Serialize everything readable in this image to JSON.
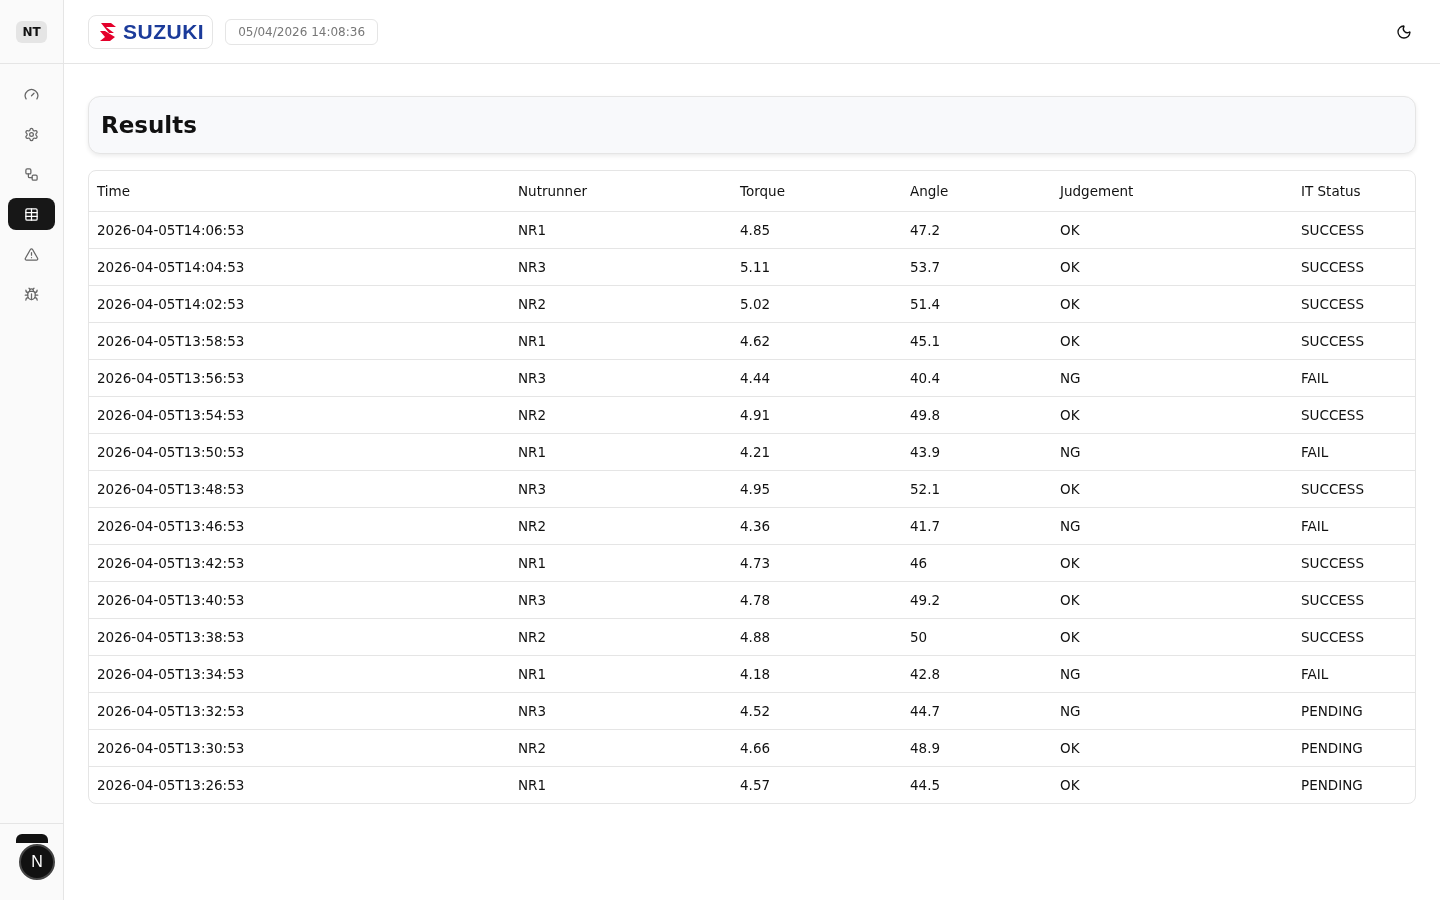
{
  "sidebar": {
    "badge": "NT",
    "items": [
      {
        "kind": "gauge",
        "selected": false
      },
      {
        "kind": "gear",
        "selected": false
      },
      {
        "kind": "network",
        "selected": false
      },
      {
        "kind": "table",
        "selected": true
      },
      {
        "kind": "warning",
        "selected": false
      },
      {
        "kind": "bug",
        "selected": false
      }
    ],
    "dev_badge": "N"
  },
  "header": {
    "logo": "SUZUKI",
    "datetime": "05/04/2026 14:08:36"
  },
  "title": "Results",
  "table": {
    "columns": [
      "Time",
      "Nutrunner",
      "Torque",
      "Angle",
      "Judgement",
      "IT Status"
    ],
    "rows": [
      [
        "2026-04-05T14:06:53",
        "NR1",
        "4.85",
        "47.2",
        "OK",
        "SUCCESS"
      ],
      [
        "2026-04-05T14:04:53",
        "NR3",
        "5.11",
        "53.7",
        "OK",
        "SUCCESS"
      ],
      [
        "2026-04-05T14:02:53",
        "NR2",
        "5.02",
        "51.4",
        "OK",
        "SUCCESS"
      ],
      [
        "2026-04-05T13:58:53",
        "NR1",
        "4.62",
        "45.1",
        "OK",
        "SUCCESS"
      ],
      [
        "2026-04-05T13:56:53",
        "NR3",
        "4.44",
        "40.4",
        "NG",
        "FAIL"
      ],
      [
        "2026-04-05T13:54:53",
        "NR2",
        "4.91",
        "49.8",
        "OK",
        "SUCCESS"
      ],
      [
        "2026-04-05T13:50:53",
        "NR1",
        "4.21",
        "43.9",
        "NG",
        "FAIL"
      ],
      [
        "2026-04-05T13:48:53",
        "NR3",
        "4.95",
        "52.1",
        "OK",
        "SUCCESS"
      ],
      [
        "2026-04-05T13:46:53",
        "NR2",
        "4.36",
        "41.7",
        "NG",
        "FAIL"
      ],
      [
        "2026-04-05T13:42:53",
        "NR1",
        "4.73",
        "46",
        "OK",
        "SUCCESS"
      ],
      [
        "2026-04-05T13:40:53",
        "NR3",
        "4.78",
        "49.2",
        "OK",
        "SUCCESS"
      ],
      [
        "2026-04-05T13:38:53",
        "NR2",
        "4.88",
        "50",
        "OK",
        "SUCCESS"
      ],
      [
        "2026-04-05T13:34:53",
        "NR1",
        "4.18",
        "42.8",
        "NG",
        "FAIL"
      ],
      [
        "2026-04-05T13:32:53",
        "NR3",
        "4.52",
        "44.7",
        "NG",
        "PENDING"
      ],
      [
        "2026-04-05T13:30:53",
        "NR2",
        "4.66",
        "48.9",
        "OK",
        "PENDING"
      ],
      [
        "2026-04-05T13:26:53",
        "NR1",
        "4.57",
        "44.5",
        "OK",
        "PENDING"
      ]
    ]
  }
}
